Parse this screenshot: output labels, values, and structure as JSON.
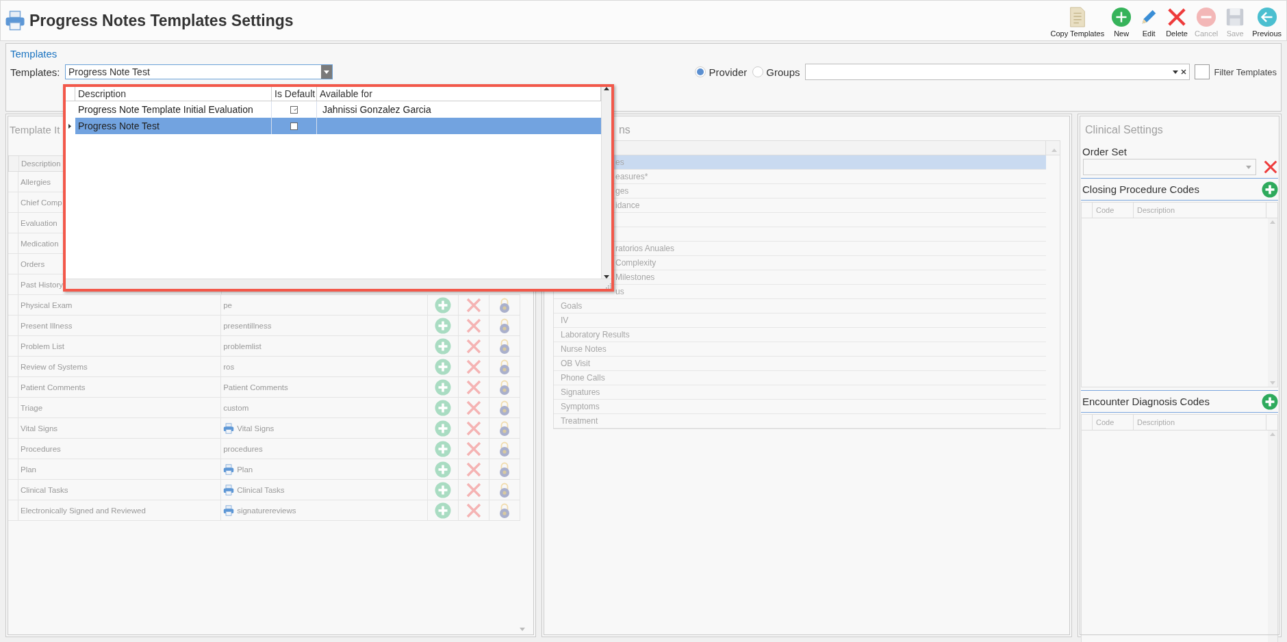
{
  "window": {
    "title": "Progress Notes Templates Settings"
  },
  "toolbar": [
    {
      "label": "Copy Templates",
      "kind": "copy",
      "disabled": false
    },
    {
      "label": "New",
      "kind": "new",
      "disabled": false
    },
    {
      "label": "Edit",
      "kind": "edit",
      "disabled": false
    },
    {
      "label": "Delete",
      "kind": "delete",
      "disabled": false
    },
    {
      "label": "Cancel",
      "kind": "cancel",
      "disabled": true
    },
    {
      "label": "Save",
      "kind": "save",
      "disabled": true
    },
    {
      "label": "Previous",
      "kind": "previous",
      "disabled": false
    }
  ],
  "templates": {
    "title": "Templates",
    "label": "Templates:",
    "value": "Progress Note Test",
    "expanded": true,
    "radios": [
      {
        "label": "Provider",
        "selected": true
      },
      {
        "label": "Groups",
        "selected": false
      }
    ],
    "filter_checked": false,
    "filter_label": "Filter Templates"
  },
  "dropdown": {
    "columns": [
      "Description",
      "Is Default",
      "Available for"
    ],
    "rows": [
      {
        "description": "Progress Note Template Initial Evaluation",
        "is_default": true,
        "available_for": "Jahnissi Gonzalez Garcia",
        "selected": false
      },
      {
        "description": "Progress Note Test",
        "is_default": false,
        "selected": true
      }
    ]
  },
  "template_items": {
    "title": "Template It",
    "columns": [
      "Description"
    ],
    "rows": [
      {
        "description": "Allergies"
      },
      {
        "description": "Chief Comp"
      },
      {
        "description": "Evaluation"
      },
      {
        "description": "Medication"
      },
      {
        "description": "Orders"
      },
      {
        "description": "Past History"
      },
      {
        "description": "Physical Exam",
        "code": "pe",
        "kind": "plain"
      },
      {
        "description": "Present Illness",
        "code": "presentillness",
        "kind": "plain"
      },
      {
        "description": "Problem List",
        "code": "problemlist",
        "kind": "plain"
      },
      {
        "description": "Review of Systems",
        "code": "ros",
        "kind": "plain"
      },
      {
        "description": "Patient Comments",
        "code": "Patient Comments",
        "kind": "plain"
      },
      {
        "description": "Triage",
        "code": "custom",
        "kind": "plain"
      },
      {
        "description": "Vital Signs",
        "code": "Vital Signs",
        "kind": "form"
      },
      {
        "description": "Procedures",
        "code": "procedures",
        "kind": "plain"
      },
      {
        "description": "Plan",
        "code": "Plan",
        "kind": "form"
      },
      {
        "description": "Clinical Tasks",
        "code": "Clinical Tasks",
        "kind": "form"
      },
      {
        "description": "Electronically Signed and Reviewed",
        "code": "signaturereviews",
        "kind": "form"
      }
    ]
  },
  "sections": {
    "title": "ns",
    "rows": [
      {
        "label": "es",
        "kind": "cut",
        "selected": true
      },
      {
        "label": "easures*",
        "kind": "cut",
        "selected": false
      },
      {
        "label": "ges",
        "kind": "cut",
        "selected": false
      },
      {
        "label": "idance",
        "kind": "cut",
        "selected": false
      },
      {
        "selected": false
      },
      {
        "selected": false
      },
      {
        "label": "ratorios Anuales",
        "kind": "cut",
        "selected": false
      },
      {
        "label": "Complexity",
        "kind": "cut",
        "selected": false
      },
      {
        "label": "Milestones",
        "kind": "cut",
        "selected": false
      },
      {
        "label": "us",
        "kind": "cut",
        "selected": false
      },
      {
        "label": "Goals",
        "kind": "full",
        "selected": false
      },
      {
        "label": "IV",
        "kind": "full",
        "selected": false
      },
      {
        "label": "Laboratory Results",
        "kind": "full",
        "selected": false
      },
      {
        "label": "Nurse Notes",
        "kind": "full",
        "selected": false
      },
      {
        "label": "OB Visit",
        "kind": "full",
        "selected": false
      },
      {
        "label": "Phone Calls",
        "kind": "full",
        "selected": false
      },
      {
        "label": "Signatures",
        "kind": "full",
        "selected": false
      },
      {
        "label": "Symptoms",
        "kind": "full",
        "selected": false
      },
      {
        "label": "Treatment",
        "kind": "full",
        "selected": false
      }
    ]
  },
  "clinical_settings": {
    "title": "Clinical Settings",
    "order_set_label": "Order Set",
    "closing_title": "Closing Procedure Codes",
    "closing_columns": [
      "Code",
      "Description"
    ],
    "encounter_title": "Encounter Diagnosis Codes",
    "encounter_columns": [
      "Code",
      "Description"
    ]
  }
}
